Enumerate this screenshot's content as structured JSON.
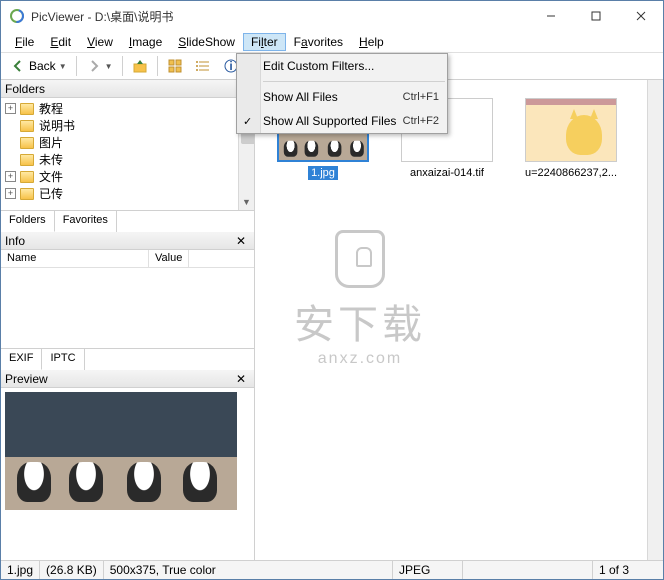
{
  "titlebar": {
    "title": "PicViewer - D:\\桌面\\说明书"
  },
  "menubar": {
    "items": [
      {
        "label": "File",
        "underline": "F"
      },
      {
        "label": "Edit",
        "underline": "E"
      },
      {
        "label": "View",
        "underline": "V"
      },
      {
        "label": "Image",
        "underline": "I"
      },
      {
        "label": "SlideShow",
        "underline": "S"
      },
      {
        "label": "Filter",
        "underline": "l"
      },
      {
        "label": "Favorites",
        "underline": "a"
      },
      {
        "label": "Help",
        "underline": "H"
      }
    ]
  },
  "toolbar": {
    "back": "Back"
  },
  "dropdown": {
    "edit": "Edit Custom Filters...",
    "all": "Show All Files",
    "all_sc": "Ctrl+F1",
    "supported": "Show All Supported Files",
    "supported_sc": "Ctrl+F2"
  },
  "panels": {
    "folders": "Folders",
    "favorites": "Favorites",
    "info": "Info",
    "preview": "Preview",
    "info_cols": {
      "name": "Name",
      "value": "Value"
    },
    "info_tabs": {
      "exif": "EXIF",
      "iptc": "IPTC"
    }
  },
  "tree": [
    {
      "exp": "+",
      "label": "教程"
    },
    {
      "exp": "",
      "label": "说明书"
    },
    {
      "exp": "",
      "label": "图片"
    },
    {
      "exp": "",
      "label": "未传"
    },
    {
      "exp": "+",
      "label": "文件"
    },
    {
      "exp": "+",
      "label": "已传"
    }
  ],
  "thumbs": [
    {
      "label": "1.jpg",
      "selected": true,
      "kind": "puppies"
    },
    {
      "label": "anxaizai-014.tif",
      "selected": false,
      "kind": "blank"
    },
    {
      "label": "u=2240866237,2...",
      "selected": false,
      "kind": "cat"
    }
  ],
  "status": {
    "file": "1.jpg",
    "size": "(26.8 KB)",
    "dims": "500x375, True color",
    "type": "JPEG",
    "count": "1 of 3"
  },
  "watermark": {
    "cn": "安下载",
    "en": "anxz.com"
  }
}
